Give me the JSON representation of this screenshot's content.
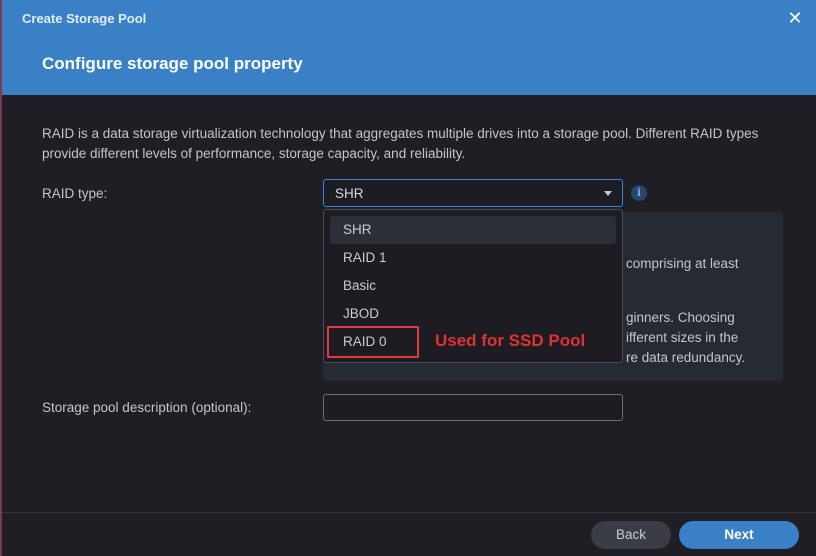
{
  "window": {
    "title": "Create Storage Pool",
    "close_icon": "close-icon",
    "close_glyph": "✕"
  },
  "page": {
    "title": "Configure storage pool property",
    "description": "RAID is a data storage virtualization technology that aggregates multiple drives into a storage pool. Different RAID types provide different levels of performance, storage capacity, and reliability."
  },
  "raid": {
    "label": "RAID type:",
    "selected": "SHR",
    "options": [
      "SHR",
      "RAID 1",
      "Basic",
      "JBOD",
      "RAID 0"
    ],
    "info_icon": "info-icon",
    "info_glyph": "i"
  },
  "info_panel": {
    "line1": "comprising at least",
    "line2": "ginners. Choosing",
    "line3": "ifferent sizes in the",
    "line4": "re data redundancy."
  },
  "annotation": {
    "text": "Used for SSD Pool",
    "color": "#e03232"
  },
  "description_field": {
    "label": "Storage pool description (optional):",
    "value": "",
    "placeholder": ""
  },
  "footer": {
    "back_label": "Back",
    "next_label": "Next"
  },
  "colors": {
    "accent": "#3a80c7",
    "background": "#1e1e24",
    "highlight": "#e03b3b"
  }
}
